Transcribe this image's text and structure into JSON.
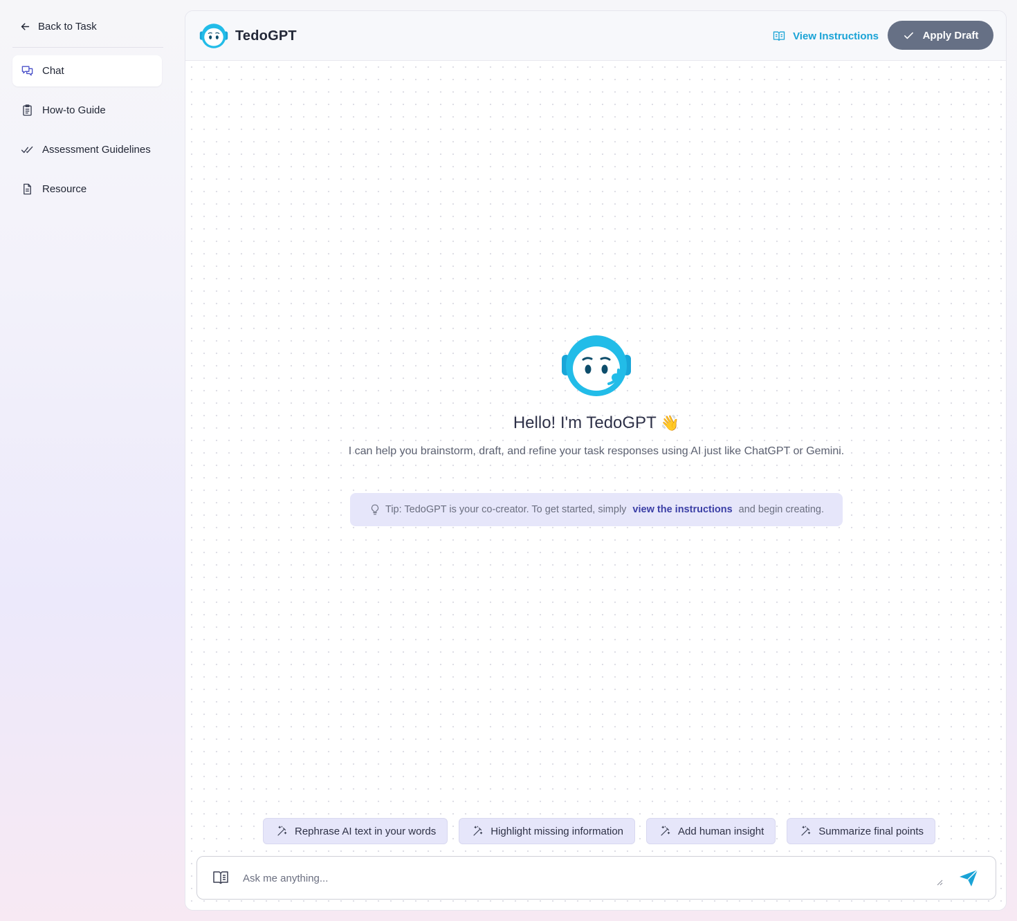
{
  "sidebar": {
    "back_label": "Back to Task",
    "items": [
      {
        "label": "Chat",
        "icon": "chat-icon",
        "active": true
      },
      {
        "label": "How-to Guide",
        "icon": "clipboard-icon",
        "active": false
      },
      {
        "label": "Assessment Guidelines",
        "icon": "double-check-icon",
        "active": false
      },
      {
        "label": "Resource",
        "icon": "document-icon",
        "active": false
      }
    ]
  },
  "header": {
    "title": "TedoGPT",
    "view_instructions": "View Instructions",
    "apply_draft": "Apply Draft"
  },
  "welcome": {
    "title": "Hello! I'm TedoGPT",
    "emoji": "👋",
    "subtitle": "I can help you brainstorm, draft, and refine your task responses using AI just like ChatGPT or Gemini."
  },
  "tip": {
    "prefix": "Tip: TedoGPT is your co-creator. To get started, simply",
    "link": "view the instructions",
    "suffix": "and begin creating."
  },
  "suggestions": [
    "Rephrase AI text in your words",
    "Highlight missing information",
    "Add human insight",
    "Summarize final points"
  ],
  "composer": {
    "placeholder": "Ask me anything..."
  },
  "colors": {
    "accent": "#1aa3d6",
    "apply_button": "#667085",
    "chip_bg": "#e6e6fa",
    "tip_link": "#3b3fa6"
  }
}
